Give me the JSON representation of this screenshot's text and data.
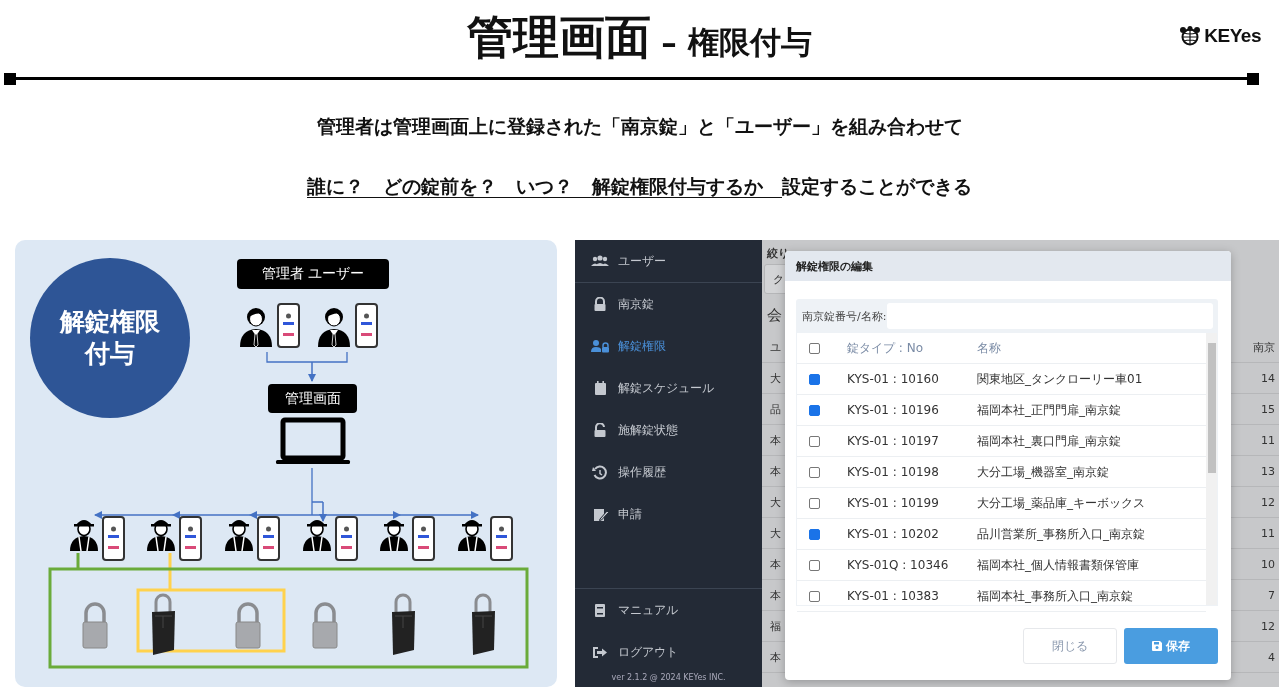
{
  "title": {
    "main": "管理画面",
    "sub": "– 権限付与"
  },
  "logo": {
    "text": "KEYes"
  },
  "intro": {
    "line1": "管理者は管理画面上に登録された「南京錠」と「ユーザー」を組み合わせて",
    "line2_underlined": "誰に？　どの錠前を？　いつ？　解錠権限付与するか　",
    "line2_rest": "設定することができる"
  },
  "diagram": {
    "badge": "解錠権限付与",
    "admin_label": "管理者 ユーザー",
    "screen_label": "管理画面",
    "locks": [
      {
        "kind": "padlock"
      },
      {
        "kind": "keybox"
      },
      {
        "kind": "padlock"
      },
      {
        "kind": "padlock"
      },
      {
        "kind": "keybox"
      },
      {
        "kind": "keybox"
      }
    ]
  },
  "app": {
    "sidebar": {
      "items": [
        {
          "label": "ユーザー",
          "selected": false
        },
        {
          "label": "南京錠",
          "selected": false
        },
        {
          "label": "解錠権限",
          "selected": true
        },
        {
          "label": "解錠スケジュール",
          "selected": false
        },
        {
          "label": "施解錠状態",
          "selected": false
        },
        {
          "label": "操作履歴",
          "selected": false
        },
        {
          "label": "申請",
          "selected": false
        }
      ],
      "footer_items": [
        {
          "label": "マニュアル"
        },
        {
          "label": "ログアウト"
        }
      ],
      "version": "ver 2.1.2 @ 2024 KEYes INC."
    },
    "background": {
      "filter_label": "絞り",
      "filter_value": "ク",
      "section_title": "会",
      "columns": [
        "ユ",
        "南京"
      ],
      "rows": [
        [
          "大",
          "14"
        ],
        [
          "品",
          "15"
        ],
        [
          "本",
          "11"
        ],
        [
          "本",
          "13"
        ],
        [
          "大",
          "12"
        ],
        [
          "大",
          "11"
        ],
        [
          "本",
          "10"
        ],
        [
          "本",
          "7"
        ],
        [
          "福",
          "12"
        ],
        [
          "本",
          "4"
        ]
      ]
    },
    "dialog": {
      "title": "解錠権限の編集",
      "search_label": "南京錠番号/名称:",
      "select_all_checked": false,
      "columns": [
        "錠タイプ : No",
        "名称"
      ],
      "rows": [
        {
          "checked": true,
          "no": "KYS-01 : 10160",
          "name": "関東地区_タンクローリー車01"
        },
        {
          "checked": true,
          "no": "KYS-01 : 10196",
          "name": "福岡本社_正門門扉_南京錠"
        },
        {
          "checked": false,
          "no": "KYS-01 : 10197",
          "name": "福岡本社_裏口門扉_南京錠"
        },
        {
          "checked": false,
          "no": "KYS-01 : 10198",
          "name": "大分工場_機器室_南京錠"
        },
        {
          "checked": false,
          "no": "KYS-01 : 10199",
          "name": "大分工場_薬品庫_キーボックス"
        },
        {
          "checked": true,
          "no": "KYS-01 : 10202",
          "name": "品川営業所_事務所入口_南京錠"
        },
        {
          "checked": false,
          "no": "KYS-01Q : 10346",
          "name": "福岡本社_個人情報書類保管庫"
        },
        {
          "checked": false,
          "no": "KYS-01 : 10383",
          "name": "福岡本社_事務所入口_南京錠"
        }
      ],
      "close_button": "閉じる",
      "save_button": "保存"
    }
  }
}
